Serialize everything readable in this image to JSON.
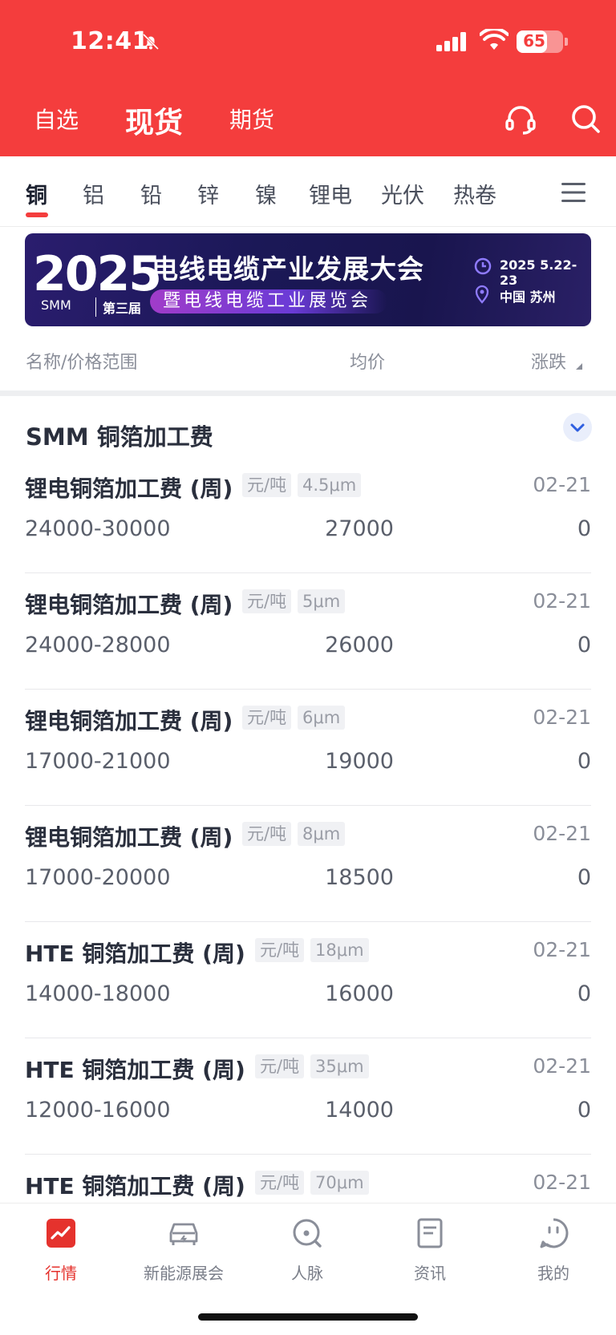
{
  "status_bar": {
    "time": "12:41",
    "battery": "65",
    "battery_level": 0.65
  },
  "top_nav": {
    "tabs": [
      "自选",
      "现货",
      "期货"
    ],
    "active": "现货"
  },
  "categories": {
    "items": [
      "铜",
      "铝",
      "铅",
      "锌",
      "镍",
      "锂电",
      "光伏",
      "热卷"
    ],
    "active": "铜"
  },
  "banner": {
    "year": "2025",
    "brand": "SMM",
    "edition": "第三届",
    "title": "电线电缆产业发展大会",
    "subtitle": "暨电线电缆工业展览会",
    "date": "2025 5.22-23",
    "location": "中国  苏州"
  },
  "columns": {
    "name": "名称/价格范围",
    "avg": "均价",
    "change": "涨跌"
  },
  "section": {
    "title": "SMM 铜箔加工费"
  },
  "rows": [
    {
      "name": "锂电铜箔加工费 (周)",
      "unit": "元/吨",
      "spec": "4.5μm",
      "date": "02-21",
      "range": "24000-30000",
      "avg": "27000",
      "change": "0"
    },
    {
      "name": "锂电铜箔加工费 (周)",
      "unit": "元/吨",
      "spec": "5μm",
      "date": "02-21",
      "range": "24000-28000",
      "avg": "26000",
      "change": "0"
    },
    {
      "name": "锂电铜箔加工费 (周)",
      "unit": "元/吨",
      "spec": "6μm",
      "date": "02-21",
      "range": "17000-21000",
      "avg": "19000",
      "change": "0"
    },
    {
      "name": "锂电铜箔加工费 (周)",
      "unit": "元/吨",
      "spec": "8μm",
      "date": "02-21",
      "range": "17000-20000",
      "avg": "18500",
      "change": "0"
    },
    {
      "name": "HTE 铜箔加工费 (周)",
      "unit": "元/吨",
      "spec": "18μm",
      "date": "02-21",
      "range": "14000-18000",
      "avg": "16000",
      "change": "0"
    },
    {
      "name": "HTE 铜箔加工费 (周)",
      "unit": "元/吨",
      "spec": "35μm",
      "date": "02-21",
      "range": "12000-16000",
      "avg": "14000",
      "change": "0"
    },
    {
      "name": "HTE 铜箔加工费 (周)",
      "unit": "元/吨",
      "spec": "70μm",
      "date": "02-21",
      "range": "",
      "avg": "",
      "change": ""
    }
  ],
  "bottom_nav": {
    "items": [
      {
        "label": "行情",
        "icon": "market-chart-icon"
      },
      {
        "label": "新能源展会",
        "icon": "car-icon"
      },
      {
        "label": "人脉",
        "icon": "contacts-search-icon"
      },
      {
        "label": "资讯",
        "icon": "news-icon"
      },
      {
        "label": "我的",
        "icon": "profile-icon"
      }
    ],
    "active": "行情"
  },
  "colors": {
    "brand_red": "#f43d3d",
    "text_dark": "#2a2f3d",
    "text_gray": "#8a8e99"
  }
}
